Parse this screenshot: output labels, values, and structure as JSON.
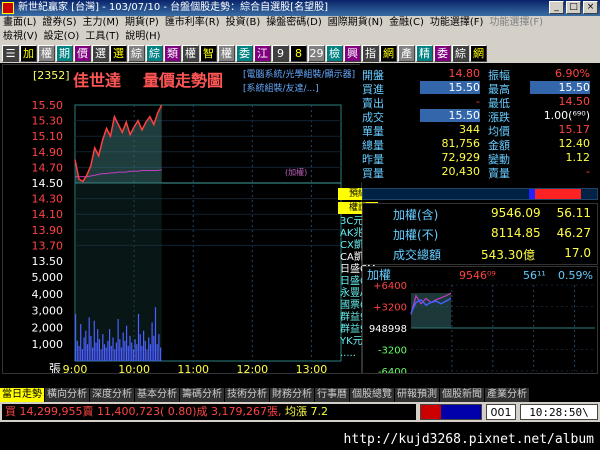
{
  "window": {
    "title": "新世紀贏家 [台灣] - 103/07/10 - 台盤個股走勢：綜合自選股[名望股]",
    "min_label": "_",
    "max_label": "□",
    "close_label": "×"
  },
  "menu1": [
    "畫面(L)",
    "證券(S)",
    "主力(M)",
    "期貨(P)",
    "匯市利率(R)",
    "投資(B)",
    "操盤密碼(D)",
    "國際期貨(N)",
    "金融(C)",
    "功能選擇(F)",
    "功能選擇(F)"
  ],
  "menu2": [
    "檢視(V)",
    "設定(O)",
    "工具(T)",
    "說明(H)"
  ],
  "toolbar": [
    "☰",
    "加",
    "權",
    "期",
    "價",
    "選",
    "選",
    "綜",
    "綜",
    "類",
    "權",
    "智",
    "權",
    "委",
    "江",
    "9",
    "8",
    "29",
    "檢",
    "興",
    "指",
    "網",
    "產",
    "精",
    "委",
    "綜",
    "網"
  ],
  "stock": {
    "code": "[2352]",
    "name": "佳世達",
    "chart_title": "量價走勢圖",
    "groups_line1": "[電腦系統/光學組裝/顯示器]",
    "groups_line2": "[系統組裝/友達/...]",
    "y_price_unit_label": "(加權)",
    "y_volume_unit_label": "張"
  },
  "quote": {
    "open_label": "開盤",
    "open": "14.80",
    "amp_label": "振幅",
    "amp": "6.90%",
    "bid_label": "買進",
    "bid": "15.50",
    "high_label": "最高",
    "high": "15.50",
    "ask_label": "賣出",
    "ask": "-",
    "low_label": "最低",
    "low": "14.50",
    "last_label": "成交",
    "last": "15.50",
    "change_label": "漲跌",
    "change": "1.00(⁶⁹⁰)",
    "unit_label": "單量",
    "unit": "344",
    "avg_label": "均價",
    "avg": "15.17",
    "total_label": "總量",
    "total": "81,756",
    "amount_label": "金額",
    "amount": "12.40",
    "prev_label": "昨量",
    "prev": "72,929",
    "var_label": "變動",
    "var": "1.12",
    "buyq_label": "買量",
    "buyq": "20,430",
    "sellq_label": "賣量",
    "sellq": "-"
  },
  "broker_tags": [
    "預細",
    "權證"
  ],
  "brokers": [
    "3C元富",
    "AK兆豐",
    "CX凱基",
    "CA凱基",
    "日盛CM",
    "日盛CF",
    "永豐AG",
    "國票CE",
    "群益98",
    "群益97",
    "YK元大",
    "....."
  ],
  "index": {
    "w_label": "加權(含)",
    "w_value": "9546.09",
    "w_chg": "56.11",
    "wn_label": "加權(不)",
    "wn_value": "8114.85",
    "wn_chg": "46.27",
    "amt_label": "成交總額",
    "amt_value": "543.30億",
    "amt_chg": "17.0"
  },
  "mini": {
    "label": "加權",
    "value": "9546⁰⁹",
    "chg": "56¹¹",
    "pct": "0.59%",
    "ticks": [
      "+6400",
      "+3200",
      "948998",
      "-3200",
      "-6400"
    ]
  },
  "tabs": [
    "當日走勢",
    "橫向分析",
    "深度分析",
    "基本分析",
    "籌碼分析",
    "技術分析",
    "財務分析",
    "行事曆",
    "個股總覽",
    "研報預測",
    "個股新聞",
    "產業分析"
  ],
  "status": {
    "ticker_buy": "買 14,299,955賣 11,400,723( 0.80)成 3,179,267張,",
    "ticker_up": " 均漲 7.2",
    "page": "001",
    "clock": "10:28:50\\"
  },
  "watermark": "http://kujd3268.pixnet.net/album",
  "colors": {
    "price_line": "#ff4040",
    "avg_line": "#c040c0",
    "area_fill": "#3a7070",
    "volume_bar": "#4a60ff",
    "ref_line": "#40a0a0"
  },
  "chart_data": [
    {
      "type": "line",
      "title": "量價走勢圖",
      "x_ticks": [
        "9:00",
        "10:00",
        "11:00",
        "12:00",
        "13:00"
      ],
      "y_ticks": [
        "15.50",
        "15.30",
        "15.10",
        "14.90",
        "14.70",
        "14.50",
        "14.30",
        "14.10",
        "13.90",
        "13.70",
        "13.50"
      ],
      "ylim": [
        13.5,
        15.5
      ],
      "reference": 14.5,
      "x_minutes": [
        0,
        4,
        8,
        12,
        16,
        20,
        24,
        28,
        32,
        36,
        40,
        44,
        48,
        52,
        56,
        60,
        64,
        68,
        72,
        76,
        80,
        84,
        88
      ],
      "series": [
        {
          "name": "成交",
          "values": [
            14.8,
            14.55,
            14.52,
            14.6,
            14.72,
            14.95,
            14.85,
            15.05,
            15.2,
            15.1,
            15.35,
            15.25,
            15.15,
            15.28,
            15.12,
            15.22,
            15.3,
            15.18,
            15.28,
            15.35,
            15.25,
            15.4,
            15.5
          ]
        },
        {
          "name": "均價",
          "values": [
            14.58,
            14.58,
            14.58,
            14.58,
            14.59,
            14.6,
            14.61,
            14.62,
            14.62,
            14.63,
            14.63,
            14.64,
            14.64,
            14.64,
            14.65,
            14.65,
            14.65,
            14.66,
            14.66,
            14.66,
            14.66,
            14.66,
            14.67
          ]
        }
      ]
    },
    {
      "type": "bar",
      "y_ticks": [
        "5,000",
        "4,000",
        "3,000",
        "2,000",
        "1,000",
        "0"
      ],
      "ylim": [
        0,
        5000
      ],
      "values": [
        2800,
        1200,
        900,
        2200,
        700,
        1400,
        1800,
        1000,
        2600,
        1500,
        800,
        2400,
        1100,
        1900,
        1300,
        700,
        1600,
        1000,
        800,
        1200,
        1900,
        900,
        1400,
        700,
        1100,
        2500,
        1300,
        800,
        1700,
        1200,
        2100,
        900,
        1500,
        1100,
        700,
        1300,
        1000,
        2800,
        1600,
        900,
        1800,
        1200,
        700,
        1400,
        1000,
        2300,
        1500,
        3200,
        1000,
        1600,
        800
      ]
    },
    {
      "type": "line",
      "title": "加權",
      "ylim": [
        -6400,
        6400
      ],
      "series": [
        {
          "name": "加權",
          "values": [
            2000,
            4800,
            3600,
            4400,
            3800,
            4200,
            4500,
            4800,
            5200
          ]
        },
        {
          "name": "加權",
          "values": [
            2200,
            3800,
            4200,
            3400,
            3800,
            4000,
            3600,
            4000,
            4400
          ]
        }
      ]
    }
  ]
}
